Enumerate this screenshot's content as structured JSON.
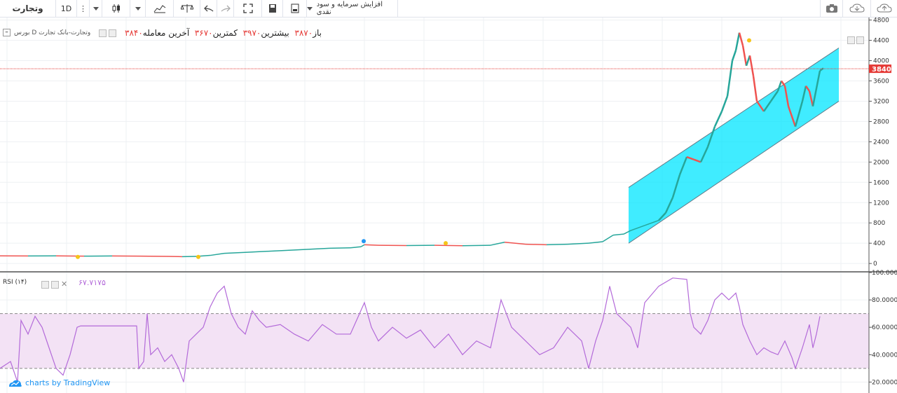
{
  "toolbar": {
    "symbol": "وتجارت",
    "interval": "1D",
    "indicator_label": "افزایش سرمایه و سود نقدی"
  },
  "legend": {
    "source": "بورس D وتجارت-بانک تجارت",
    "open_label": "باز",
    "open_value": "۳۸۷۰",
    "high_label": "بیشترین",
    "high_value": "۳۹۷۰",
    "low_label": "کمترین",
    "low_value": "۳۶۷۰",
    "close_label": "آخرین معامله",
    "close_value": "۳۸۴۰"
  },
  "rsi": {
    "label": "RSI (۱۴)",
    "value": "۶۷.۷۱۷۵"
  },
  "branding": {
    "text": "charts by TradingView"
  },
  "colors": {
    "up": "#26a69a",
    "down": "#ef5350",
    "channel": "#00e5ff",
    "rsi_line": "#b36ad9",
    "rsi_band": "#f3e2f5",
    "price_line": "#e53935"
  },
  "chart_data": [
    {
      "type": "line",
      "title": "",
      "y_axis": {
        "range": [
          -150,
          4850
        ],
        "ticks": [
          0,
          400,
          800,
          1200,
          1600,
          2000,
          2400,
          2800,
          3200,
          3600,
          4000,
          4400,
          4800
        ]
      },
      "last_price_label": "3840",
      "last_price": 3840,
      "x_range": [
        0,
        1240
      ],
      "series": [
        {
          "values": [
            [
              0,
              150
            ],
            [
              40,
              148
            ],
            [
              80,
              150
            ],
            [
              120,
              145
            ],
            [
              160,
              148
            ],
            [
              200,
              145
            ],
            [
              240,
              140
            ],
            [
              260,
              135
            ],
            [
              280,
              140
            ],
            [
              300,
              160
            ],
            [
              320,
              200
            ],
            [
              350,
              220
            ],
            [
              380,
              240
            ],
            [
              410,
              260
            ],
            [
              440,
              280
            ],
            [
              470,
              300
            ],
            [
              500,
              310
            ],
            [
              515,
              330
            ],
            [
              520,
              370
            ],
            [
              540,
              360
            ],
            [
              580,
              355
            ],
            [
              620,
              360
            ],
            [
              660,
              350
            ],
            [
              700,
              360
            ],
            [
              720,
              420
            ],
            [
              750,
              380
            ],
            [
              780,
              370
            ],
            [
              810,
              380
            ],
            [
              840,
              400
            ],
            [
              860,
              430
            ],
            [
              875,
              560
            ],
            [
              890,
              580
            ],
            [
              900,
              650
            ],
            [
              920,
              750
            ],
            [
              940,
              850
            ],
            [
              950,
              1000
            ],
            [
              960,
              1300
            ],
            [
              970,
              1750
            ],
            [
              980,
              2100
            ],
            [
              990,
              2050
            ],
            [
              1000,
              2000
            ],
            [
              1010,
              2300
            ],
            [
              1020,
              2700
            ],
            [
              1030,
              3000
            ],
            [
              1038,
              3300
            ],
            [
              1045,
              4000
            ],
            [
              1050,
              4200
            ],
            [
              1055,
              4550
            ],
            [
              1060,
              4300
            ],
            [
              1065,
              3900
            ],
            [
              1070,
              4100
            ],
            [
              1075,
              3700
            ],
            [
              1080,
              3200
            ],
            [
              1090,
              3000
            ],
            [
              1100,
              3200
            ],
            [
              1110,
              3400
            ],
            [
              1115,
              3600
            ],
            [
              1120,
              3500
            ],
            [
              1125,
              3100
            ],
            [
              1135,
              2700
            ],
            [
              1145,
              3200
            ],
            [
              1150,
              3500
            ],
            [
              1155,
              3400
            ],
            [
              1160,
              3100
            ],
            [
              1170,
              3800
            ],
            [
              1175,
              3850
            ]
          ]
        }
      ],
      "channel": {
        "upper": [
          [
            897,
            1500
          ],
          [
            1197,
            4250
          ]
        ],
        "lower": [
          [
            897,
            400
          ],
          [
            1197,
            3200
          ]
        ]
      }
    },
    {
      "type": "line",
      "title": "",
      "y_axis": {
        "range": [
          12,
          100
        ],
        "ticks": [
          20,
          40,
          60,
          80,
          100
        ],
        "tick_labels": [
          "20.0000",
          "40.0000",
          "60.0000",
          "80.0000",
          "100.0000"
        ]
      },
      "band": [
        30,
        70
      ],
      "series": [
        {
          "values": [
            [
              0,
              30
            ],
            [
              15,
              35
            ],
            [
              25,
              20
            ],
            [
              30,
              65
            ],
            [
              40,
              55
            ],
            [
              50,
              68
            ],
            [
              60,
              60
            ],
            [
              70,
              45
            ],
            [
              80,
              30
            ],
            [
              90,
              25
            ],
            [
              100,
              40
            ],
            [
              110,
              60
            ],
            [
              115,
              61
            ],
            [
              120,
              61
            ],
            [
              160,
              61
            ],
            [
              195,
              61
            ],
            [
              198,
              30
            ],
            [
              205,
              35
            ],
            [
              210,
              70
            ],
            [
              215,
              40
            ],
            [
              225,
              45
            ],
            [
              235,
              35
            ],
            [
              245,
              40
            ],
            [
              255,
              30
            ],
            [
              262,
              20
            ],
            [
              270,
              50
            ],
            [
              280,
              55
            ],
            [
              290,
              60
            ],
            [
              300,
              75
            ],
            [
              310,
              85
            ],
            [
              320,
              90
            ],
            [
              330,
              70
            ],
            [
              340,
              60
            ],
            [
              350,
              55
            ],
            [
              360,
              72
            ],
            [
              370,
              65
            ],
            [
              380,
              60
            ],
            [
              400,
              62
            ],
            [
              420,
              55
            ],
            [
              440,
              50
            ],
            [
              460,
              62
            ],
            [
              480,
              55
            ],
            [
              500,
              55
            ],
            [
              520,
              78
            ],
            [
              530,
              60
            ],
            [
              540,
              50
            ],
            [
              560,
              60
            ],
            [
              580,
              52
            ],
            [
              600,
              58
            ],
            [
              620,
              45
            ],
            [
              640,
              55
            ],
            [
              660,
              40
            ],
            [
              680,
              50
            ],
            [
              700,
              45
            ],
            [
              715,
              80
            ],
            [
              730,
              60
            ],
            [
              750,
              50
            ],
            [
              770,
              40
            ],
            [
              790,
              45
            ],
            [
              810,
              60
            ],
            [
              830,
              50
            ],
            [
              840,
              30
            ],
            [
              850,
              50
            ],
            [
              860,
              65
            ],
            [
              870,
              90
            ],
            [
              880,
              70
            ],
            [
              900,
              60
            ],
            [
              910,
              45
            ],
            [
              920,
              78
            ],
            [
              940,
              90
            ],
            [
              960,
              96
            ],
            [
              980,
              95
            ],
            [
              985,
              70
            ],
            [
              990,
              60
            ],
            [
              1000,
              55
            ],
            [
              1010,
              65
            ],
            [
              1020,
              80
            ],
            [
              1030,
              85
            ],
            [
              1040,
              80
            ],
            [
              1050,
              85
            ],
            [
              1055,
              75
            ],
            [
              1060,
              62
            ],
            [
              1070,
              50
            ],
            [
              1080,
              40
            ],
            [
              1090,
              45
            ],
            [
              1100,
              42
            ],
            [
              1110,
              40
            ],
            [
              1120,
              50
            ],
            [
              1130,
              38
            ],
            [
              1135,
              30
            ],
            [
              1145,
              45
            ],
            [
              1155,
              62
            ],
            [
              1160,
              45
            ],
            [
              1165,
              55
            ],
            [
              1170,
              68
            ]
          ]
        }
      ]
    }
  ]
}
